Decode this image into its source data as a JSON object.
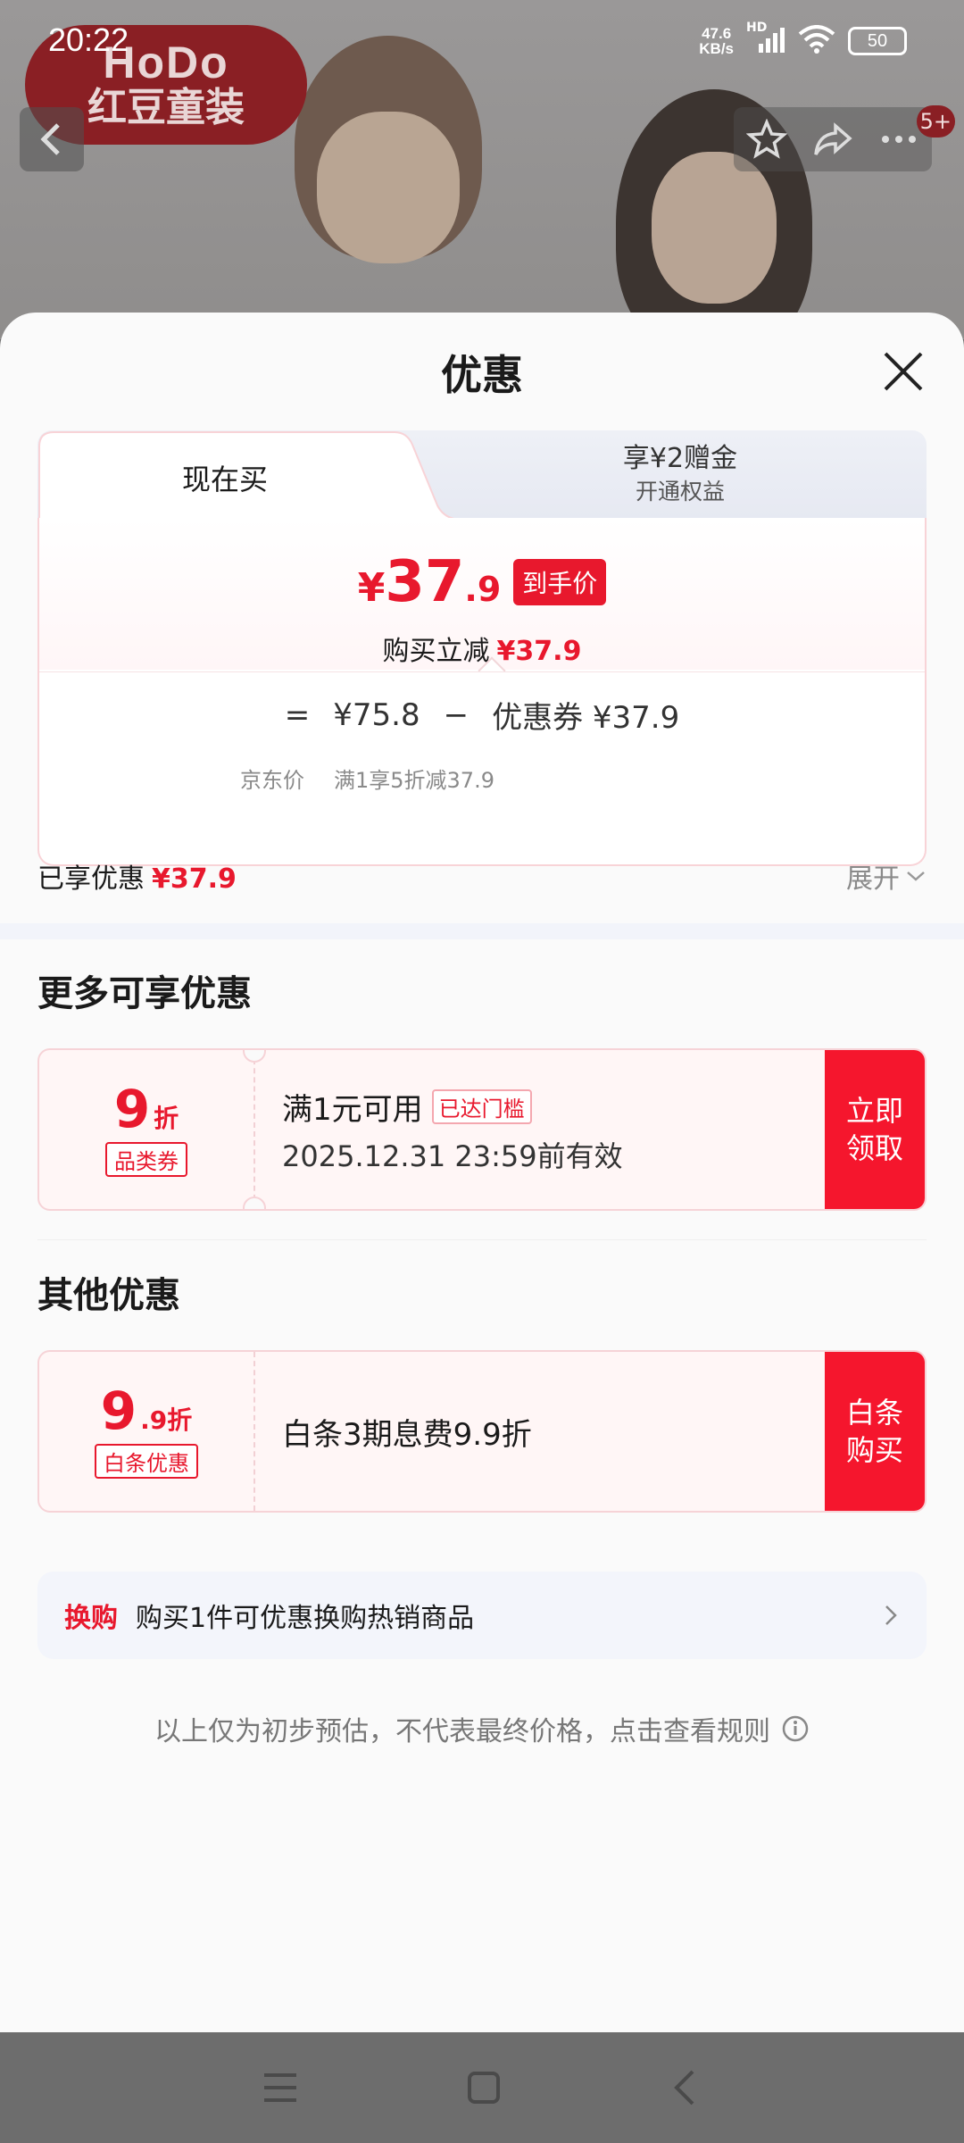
{
  "status_bar": {
    "time": "20:22",
    "net_speed_value": "47.6",
    "net_speed_unit": "KB/s",
    "network_badge": "HD",
    "battery": "50"
  },
  "background_page": {
    "brand_logo_en": "HoDo",
    "brand_logo_cn": "红豆童装",
    "message_badge": "5+"
  },
  "sheet": {
    "title": "优惠",
    "tabs": {
      "active": "现在买",
      "other_line1": "享¥2赠金",
      "other_line2": "开通权益"
    },
    "final_price": {
      "symbol": "¥",
      "integer": "37",
      "decimal": ".9",
      "tag": "到手价"
    },
    "reduction": {
      "label": "购买立减",
      "amount": "¥37.9"
    },
    "formula": {
      "equals": "=",
      "jd_price": "¥75.8",
      "minus": "−",
      "coupon_label": "优惠券",
      "coupon_amount": "¥37.9",
      "jd_price_caption": "京东价",
      "coupon_caption": "满1享5折减37.9"
    },
    "saved": {
      "label": "已享优惠",
      "amount": "¥37.9",
      "expand": "展开"
    },
    "more_section_title": "更多可享优惠",
    "category_coupon": {
      "discount_big": "9",
      "discount_unit": "折",
      "tag": "品类券",
      "condition": "满1元可用",
      "reached": "已达门槛",
      "validity": "2025.12.31 23:59前有效",
      "button": "立即领取"
    },
    "other_section_title": "其他优惠",
    "baitiao_coupon": {
      "discount_big": "9",
      "discount_small": ".9折",
      "tag": "白条优惠",
      "text": "白条3期息费9.9折",
      "button": "白条购买"
    },
    "swap": {
      "tag": "换购",
      "text": "购买1件可优惠换购热销商品"
    },
    "disclaimer": "以上仅为初步预估，不代表最终价格，点击查看规则"
  },
  "colors": {
    "accent_red": "#e8182d",
    "button_red": "#f5162d"
  }
}
